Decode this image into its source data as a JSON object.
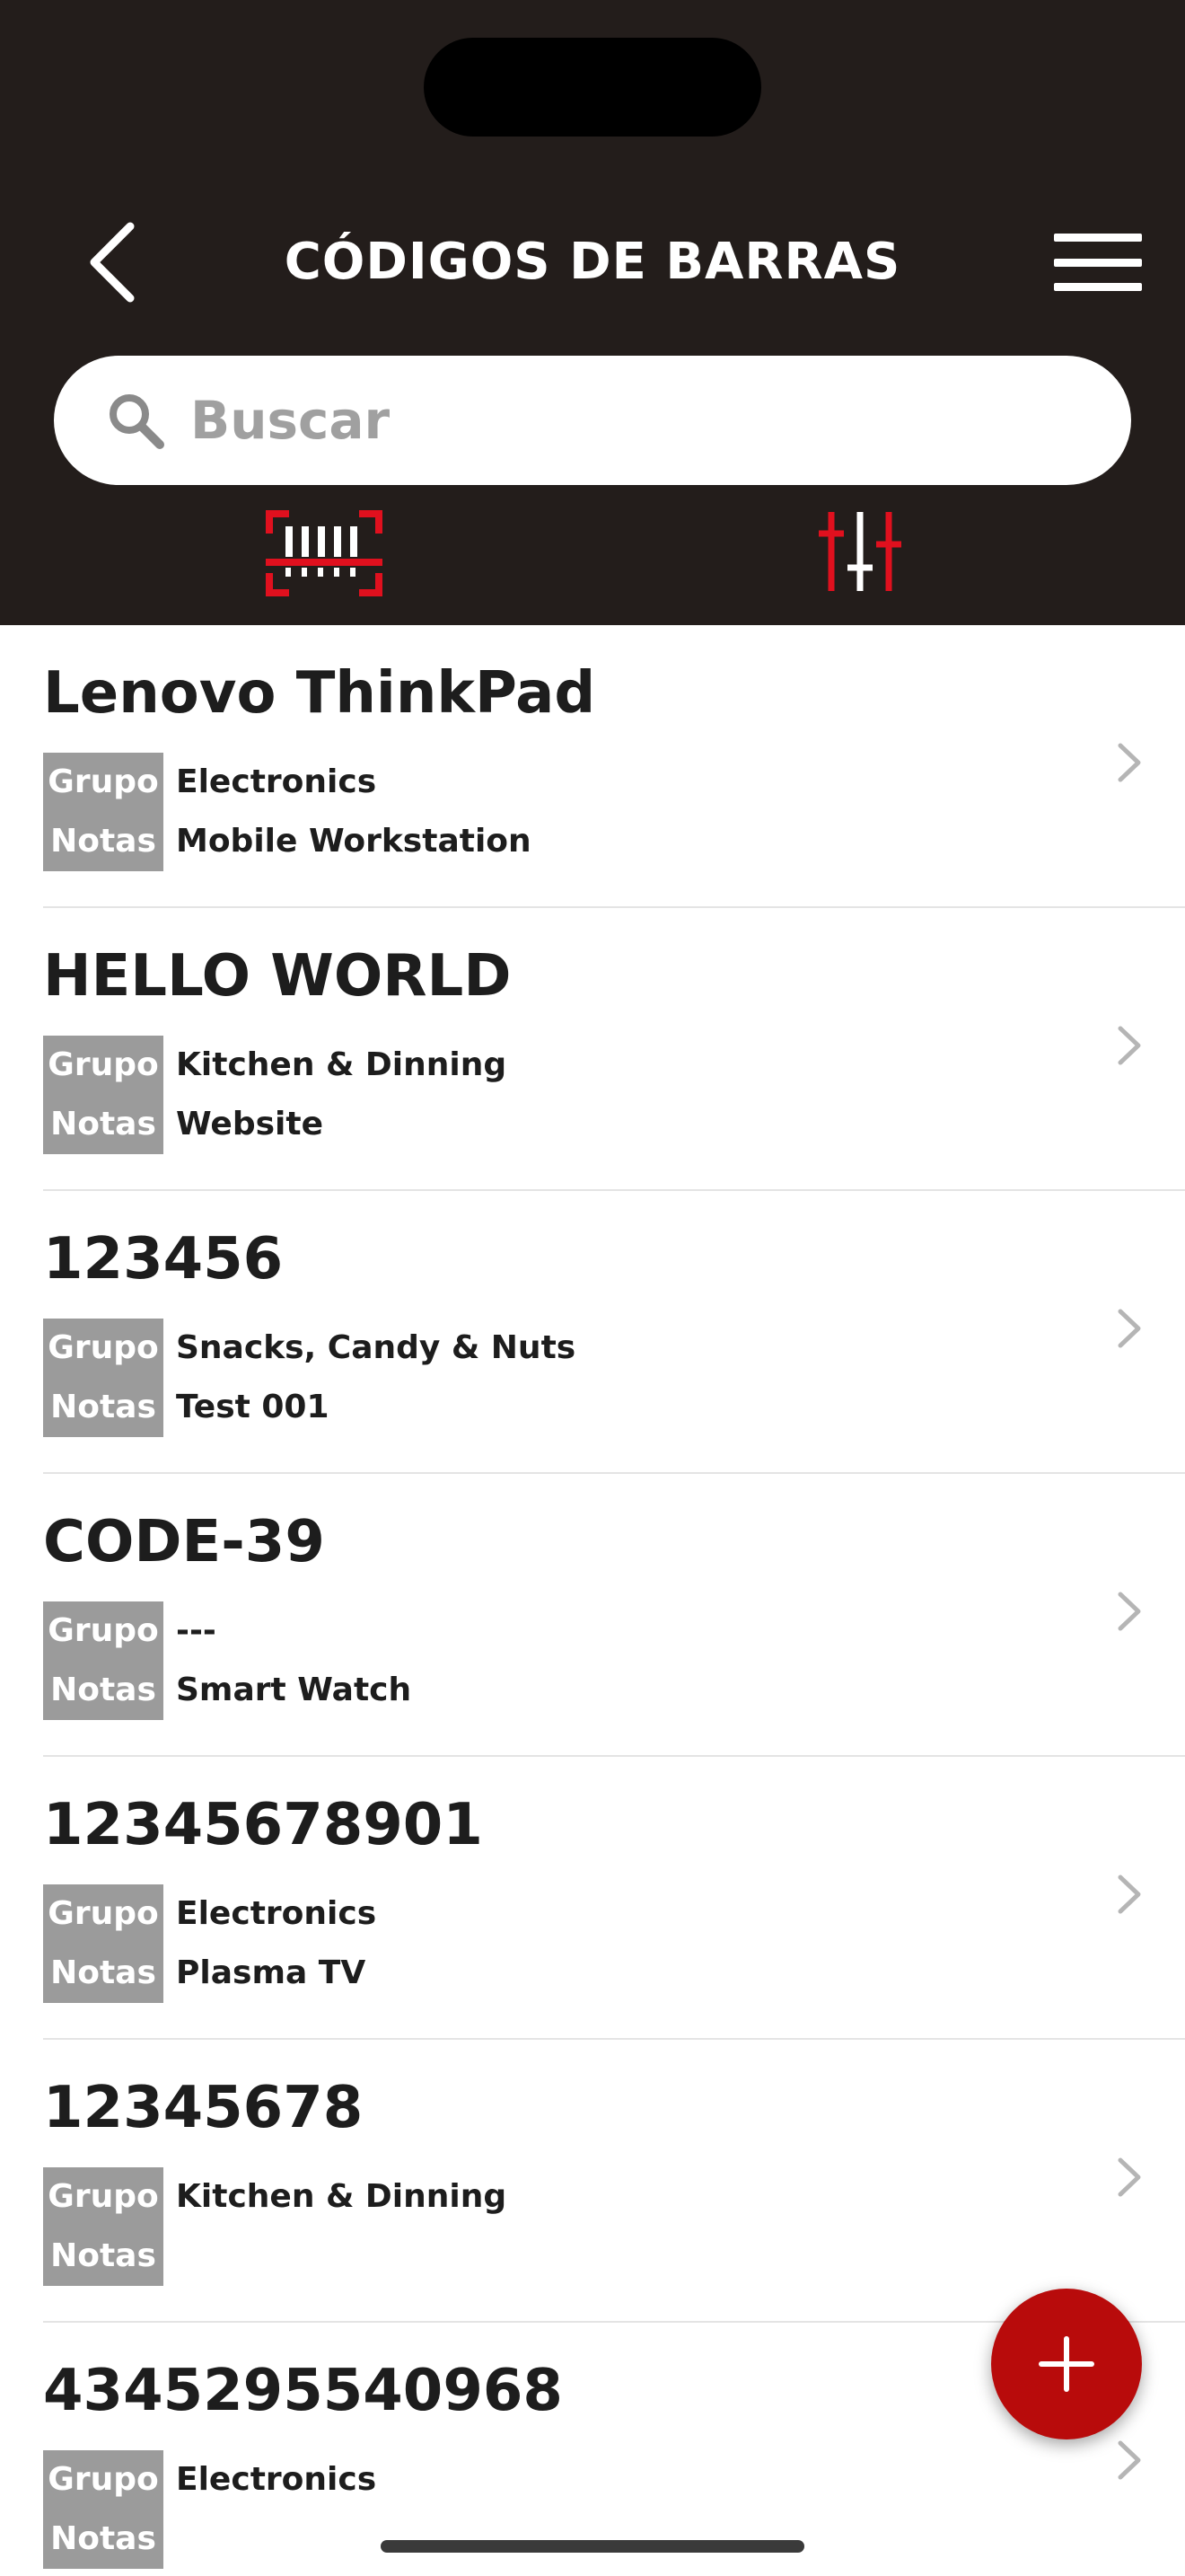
{
  "header": {
    "title": "CÓDIGOS DE BARRAS",
    "back_icon": "chevron-left-icon",
    "menu_icon": "hamburger-menu-icon"
  },
  "search": {
    "placeholder": "Buscar",
    "value": ""
  },
  "toolbar": {
    "scan_icon": "barcode-scan-icon",
    "filter_icon": "sliders-filter-icon"
  },
  "colors": {
    "header_bg": "#231d1b",
    "accent_red": "#e0101e",
    "fab_red": "#b80b0b",
    "label_bg": "#9b9b9b"
  },
  "labels": {
    "group": "Grupo",
    "notes": "Notas"
  },
  "items": [
    {
      "title": "Lenovo ThinkPad",
      "group": "Electronics",
      "notes": "Mobile Workstation"
    },
    {
      "title": "HELLO WORLD",
      "group": "Kitchen & Dinning",
      "notes": "Website"
    },
    {
      "title": "123456",
      "group": "Snacks, Candy & Nuts",
      "notes": "Test 001"
    },
    {
      "title": "CODE-39",
      "group": "---",
      "notes": "Smart Watch"
    },
    {
      "title": "12345678901",
      "group": "Electronics",
      "notes": "Plasma TV"
    },
    {
      "title": "12345678",
      "group": "Kitchen & Dinning",
      "notes": ""
    },
    {
      "title": "4345295540968",
      "group": "Electronics",
      "notes": ""
    }
  ],
  "fab": {
    "icon": "plus-icon"
  }
}
